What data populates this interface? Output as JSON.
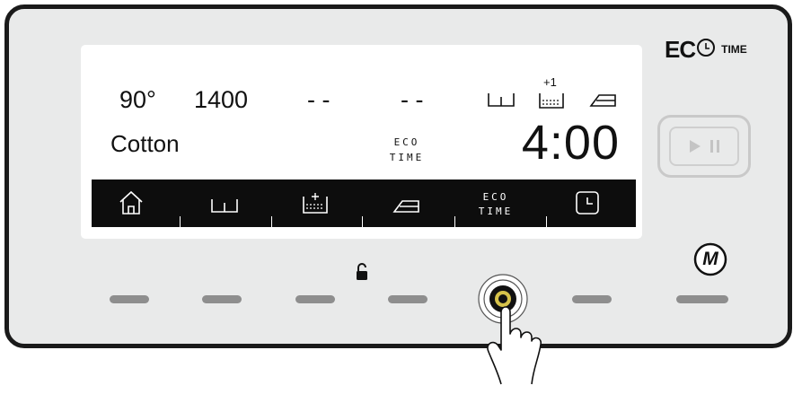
{
  "brand": {
    "eco": "EC",
    "time": "TIME"
  },
  "display": {
    "temperature": "90°",
    "spin": "1400",
    "option1": "- -",
    "option2": "- -",
    "rinse_badge": "+1",
    "program": "Cotton",
    "eco_label_line1": "ECO",
    "eco_label_line2": "TIME",
    "time_remaining": "4:00"
  },
  "menu": {
    "items": [
      {
        "icon": "home-icon"
      },
      {
        "icon": "spin-icon"
      },
      {
        "icon": "extra-rinse-icon"
      },
      {
        "icon": "easy-iron-icon"
      },
      {
        "icon": "eco-time-icon",
        "line1": "ECO",
        "line2": "TIME"
      },
      {
        "icon": "delay-timer-icon"
      }
    ]
  },
  "controls": {
    "play_pause": "play-pause-icon",
    "menu_button": "M",
    "child_lock": "lock-icon",
    "pressed_button_index": 4
  }
}
